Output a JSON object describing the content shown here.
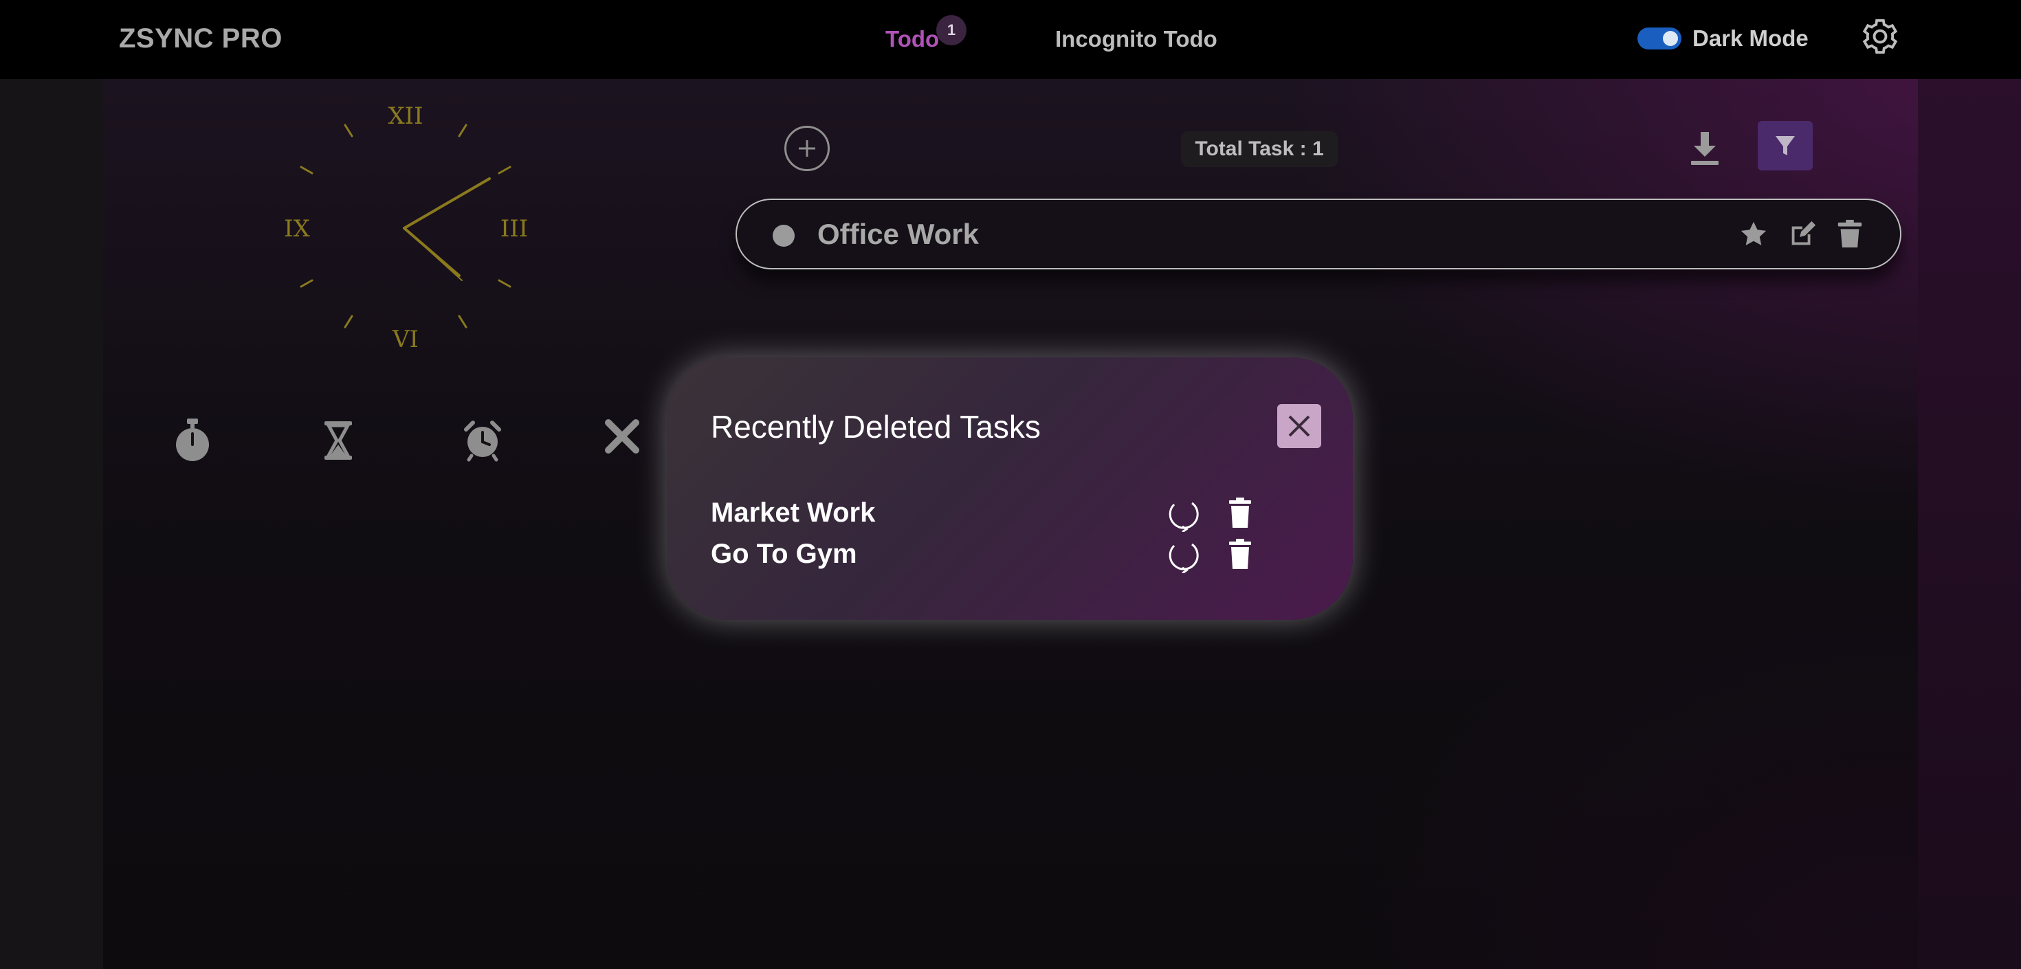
{
  "app": {
    "brand": "ZSYNC PRO"
  },
  "nav": {
    "todo_label": "Todo",
    "todo_badge": "1",
    "incognito_label": "Incognito Todo",
    "dark_mode_label": "Dark Mode",
    "dark_mode_on": true
  },
  "clock": {
    "numerals": {
      "twelve": "XII",
      "three": "III",
      "six": "VI",
      "nine": "IX"
    },
    "color": "#8a7a1e"
  },
  "tools": {
    "items": [
      {
        "name": "stopwatch-icon"
      },
      {
        "name": "hourglass-icon"
      },
      {
        "name": "alarm-clock-icon"
      }
    ]
  },
  "todo": {
    "total_label": "Total Task : 1",
    "tasks": [
      {
        "title": "Office Work"
      }
    ]
  },
  "modal": {
    "title": "Recently Deleted Tasks",
    "items": [
      {
        "name": "Market Work"
      },
      {
        "name": "Go To Gym"
      }
    ]
  },
  "colors": {
    "accent": "#b052b8",
    "toggle": "#1a5fbf",
    "filter_bg": "#4a2a6b",
    "modal_close_bg": "#c9a6c8"
  }
}
